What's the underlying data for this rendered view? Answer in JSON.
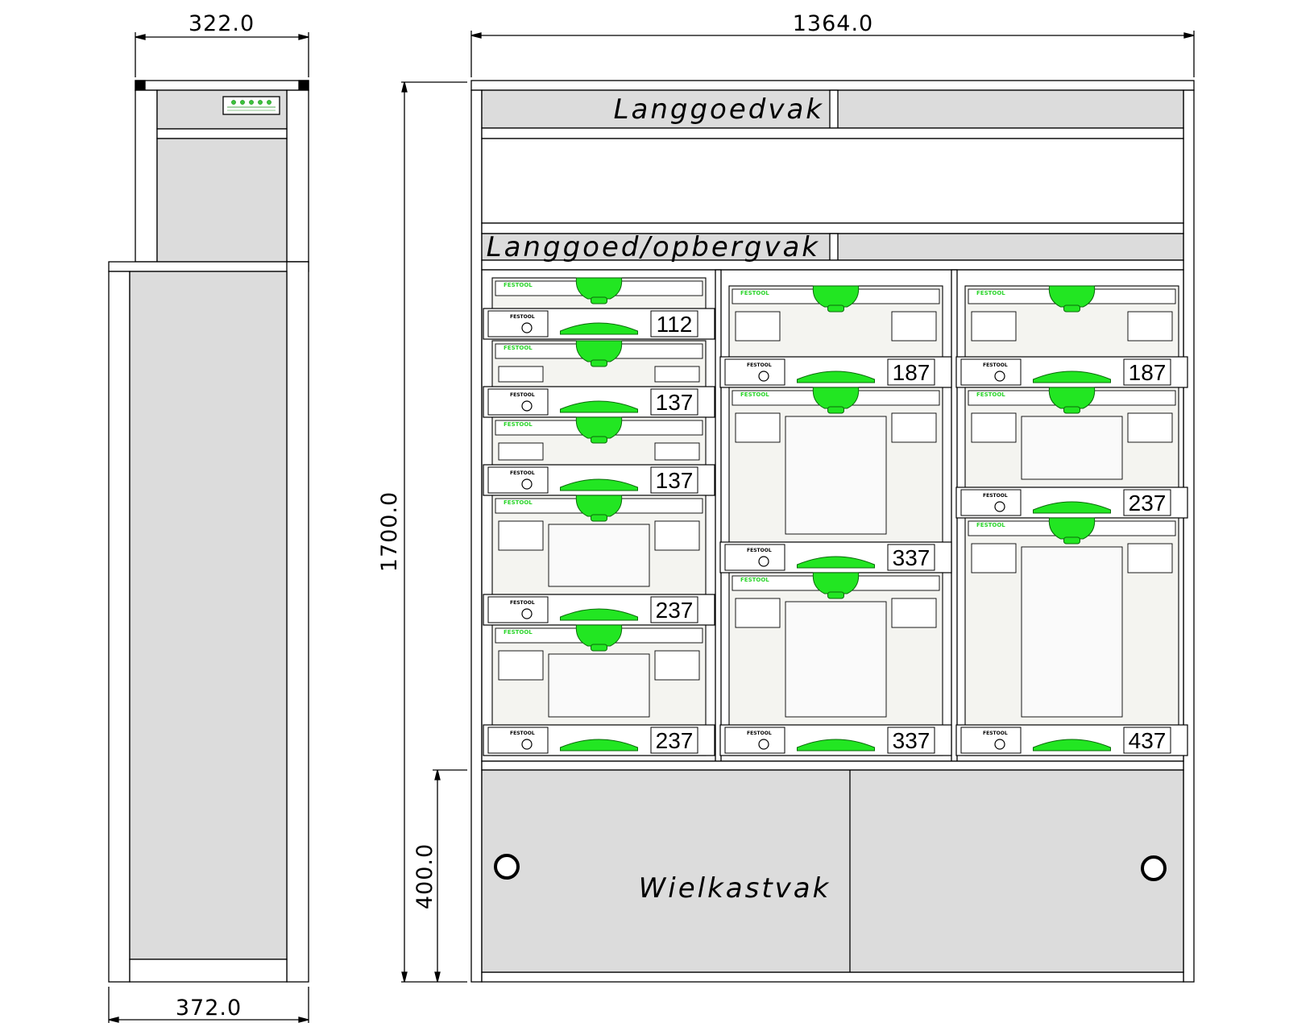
{
  "dimensions": {
    "side_top_width": "322.0",
    "side_bottom_width": "372.0",
    "front_width": "1364.0",
    "front_height": "1700.0",
    "wheel_height": "400.0"
  },
  "compartments": {
    "long_goods": "Langgoedvak",
    "long_goods_storage": "Langgoed/opbergvak",
    "wheel_box": "Wielkastvak"
  },
  "systainer_brand": "FESTOOL",
  "columns": [
    {
      "name": "left",
      "systainers": [
        "112",
        "137",
        "137",
        "237",
        "237"
      ]
    },
    {
      "name": "middle",
      "systainers": [
        "187",
        "337",
        "337"
      ]
    },
    {
      "name": "right",
      "systainers": [
        "187",
        "237",
        "437"
      ]
    }
  ],
  "colors": {
    "line": "#000000",
    "panel_fill": "#dcdcdc",
    "systainer_body": "#f4f4f0",
    "handle_green": "#22e622"
  }
}
